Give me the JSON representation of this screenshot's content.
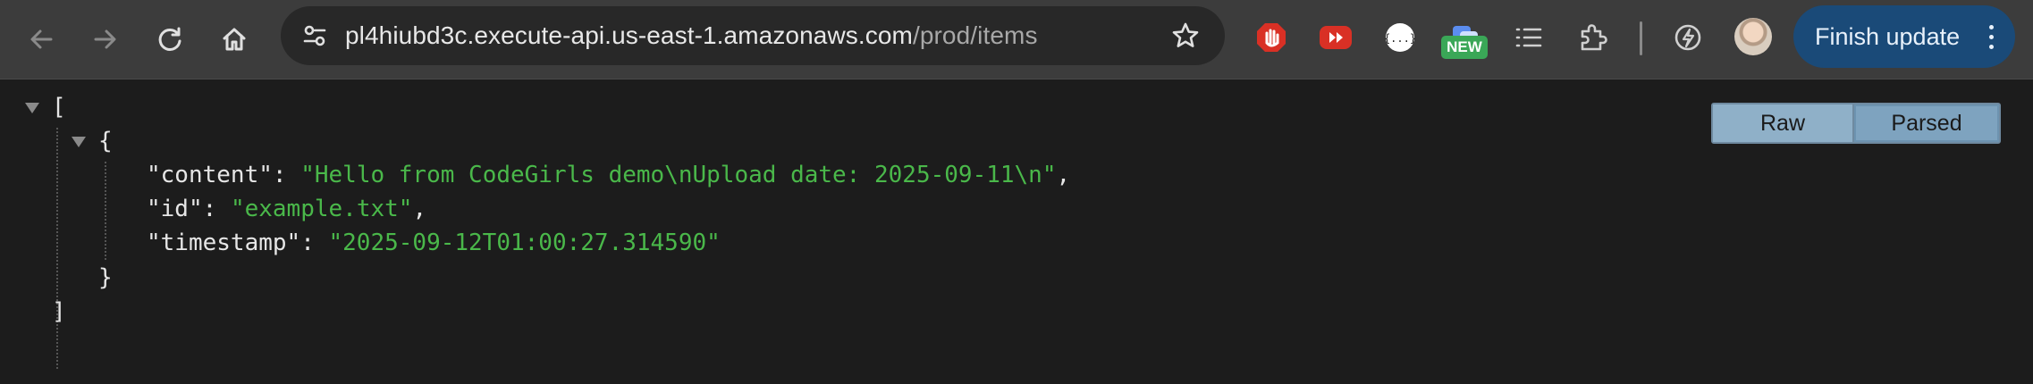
{
  "browser": {
    "url_host": "pl4hiubd3c.execute-api.us-east-1.amazonaws.com",
    "url_path": "/prod/items",
    "new_badge": "NEW",
    "finish_update_label": "Finish update",
    "icons": [
      "back-icon",
      "forward-icon",
      "reload-icon",
      "home-icon",
      "site-info-icon",
      "bookmark-star-icon",
      "adblock-extension-icon",
      "video-extension-icon",
      "json-extension-icon",
      "chat-extension-icon",
      "reading-list-icon",
      "extensions-puzzle-icon",
      "performance-icon",
      "profile-avatar",
      "more-menu-icon"
    ]
  },
  "viewer": {
    "toggle": {
      "raw": "Raw",
      "parsed": "Parsed",
      "selected": "Parsed"
    },
    "open_bracket": "[",
    "close_bracket": "]",
    "open_brace": "{",
    "close_brace": "}",
    "entries": [
      {
        "key": "\"content\"",
        "value": "\"Hello from CodeGirls demo\\nUpload date: 2025-09-11\\n\"",
        "trail": ","
      },
      {
        "key": "\"id\"",
        "value": "\"example.txt\"",
        "trail": ","
      },
      {
        "key": "\"timestamp\"",
        "value": "\"2025-09-12T01:00:27.314590\"",
        "trail": ""
      }
    ],
    "colon": ": "
  }
}
